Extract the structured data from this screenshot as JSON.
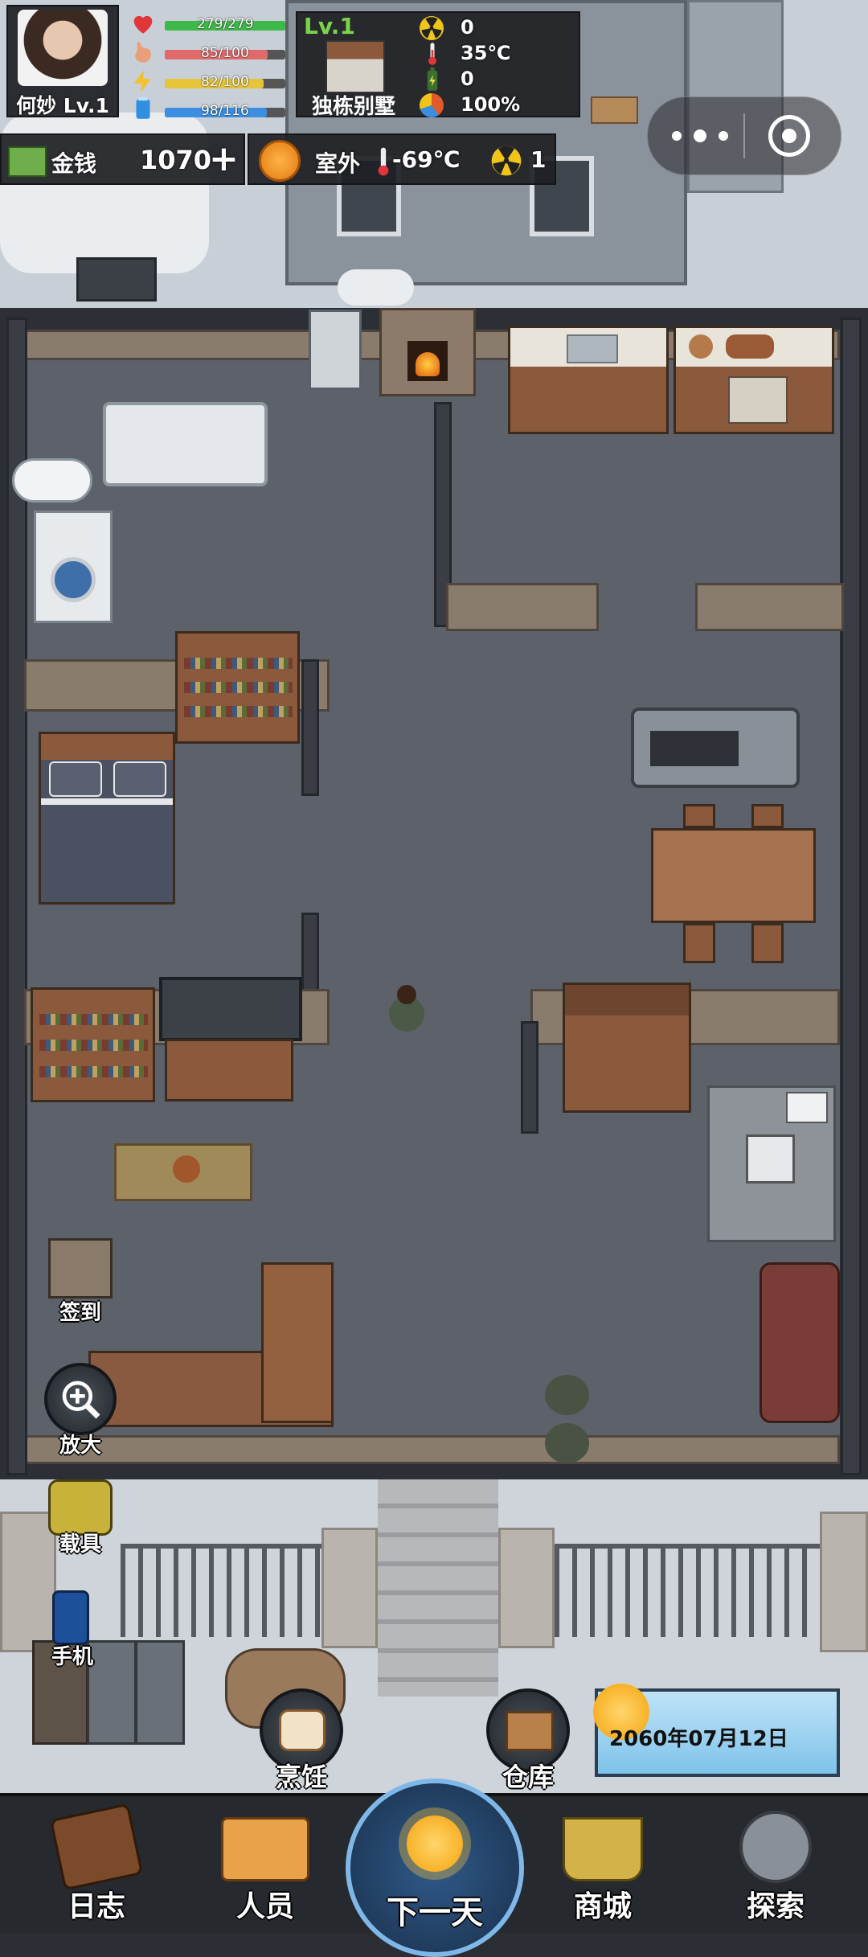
{
  "player": {
    "name_level": "何妙 Lv.1",
    "stats": [
      {
        "icon": "heart-icon",
        "value_text": "279/279",
        "fraction": 1.0,
        "color": "#3fb84a"
      },
      {
        "icon": "stomach-icon",
        "value_text": "85/100",
        "fraction": 0.85,
        "color": "#e06a6a"
      },
      {
        "icon": "energy-icon",
        "value_text": "82/100",
        "fraction": 0.82,
        "color": "#e6c53a"
      },
      {
        "icon": "water-icon",
        "value_text": "98/116",
        "fraction": 0.845,
        "color": "#3b8ee0"
      }
    ]
  },
  "building": {
    "level": "Lv.1",
    "name": "独栋别墅",
    "stats": [
      {
        "icon": "radiation-icon",
        "value": "0"
      },
      {
        "icon": "thermometer-icon",
        "value": "35℃"
      },
      {
        "icon": "battery-icon",
        "value": "0"
      },
      {
        "icon": "durability-icon",
        "value": "100%"
      }
    ]
  },
  "money": {
    "label": "金钱",
    "amount": "1070",
    "add": "+"
  },
  "weather": {
    "location": "室外",
    "temperature": "-69℃",
    "radiation": "1"
  },
  "side_buttons": {
    "sign_in": "签到",
    "zoom": "放大",
    "vehicle": "载具",
    "phone": "手机"
  },
  "action_buttons": {
    "cook": "烹饪",
    "storage": "仓库"
  },
  "date": "2060年07月12日",
  "nav": {
    "journal": "日志",
    "people": "人员",
    "next_day": "下一天",
    "shop": "商城",
    "explore": "探索"
  },
  "colors": {
    "health": "#3fb84a",
    "hunger": "#e06a6a",
    "energy": "#e6c53a",
    "thirst": "#3b8ee0",
    "level": "#7bd34a"
  }
}
